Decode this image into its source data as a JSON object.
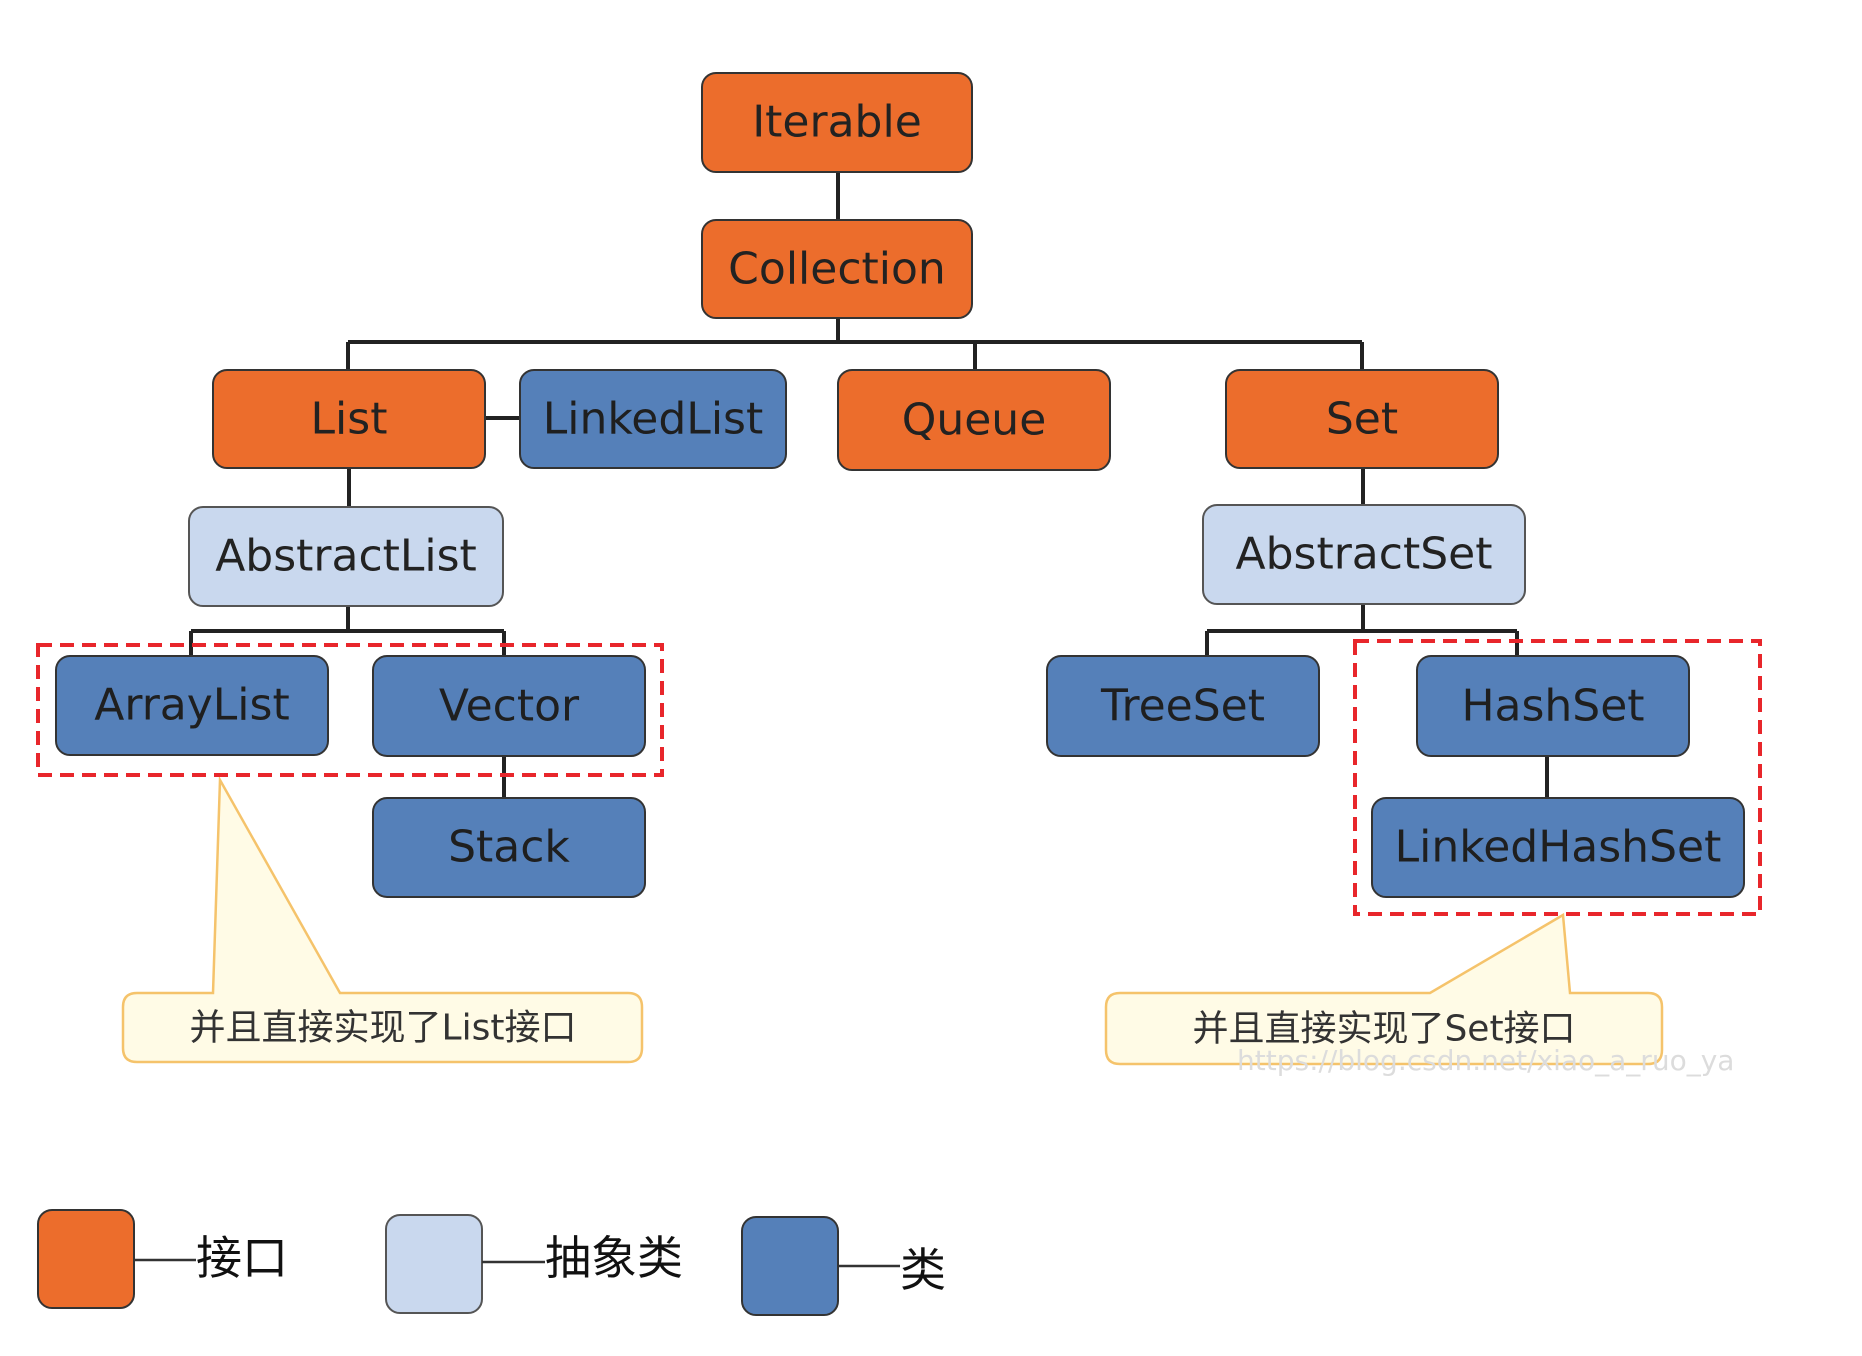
{
  "colors": {
    "interface": "#ec6d2c",
    "abstract": "#c9d8ee",
    "class": "#5580b9",
    "highlight": "#e8262b",
    "callout_fill": "#fffbe6",
    "callout_stroke": "#f5c36b",
    "connector": "#222222"
  },
  "nodes": {
    "iterable": "Iterable",
    "collection": "Collection",
    "list": "List",
    "linkedlist": "LinkedList",
    "queue": "Queue",
    "set": "Set",
    "abstractlist": "AbstractList",
    "abstractset": "AbstractSet",
    "arraylist": "ArrayList",
    "vector": "Vector",
    "stack": "Stack",
    "treeset": "TreeSet",
    "hashset": "HashSet",
    "linkedhashset": "LinkedHashSet"
  },
  "callouts": {
    "list_note": "并且直接实现了List接口",
    "set_note": "并且直接实现了Set接口"
  },
  "legend": {
    "interface_label": "接口",
    "abstract_label": "抽象类",
    "class_label": "类"
  },
  "watermark": "https://blog.csdn.net/xiao_a_ruo_ya"
}
